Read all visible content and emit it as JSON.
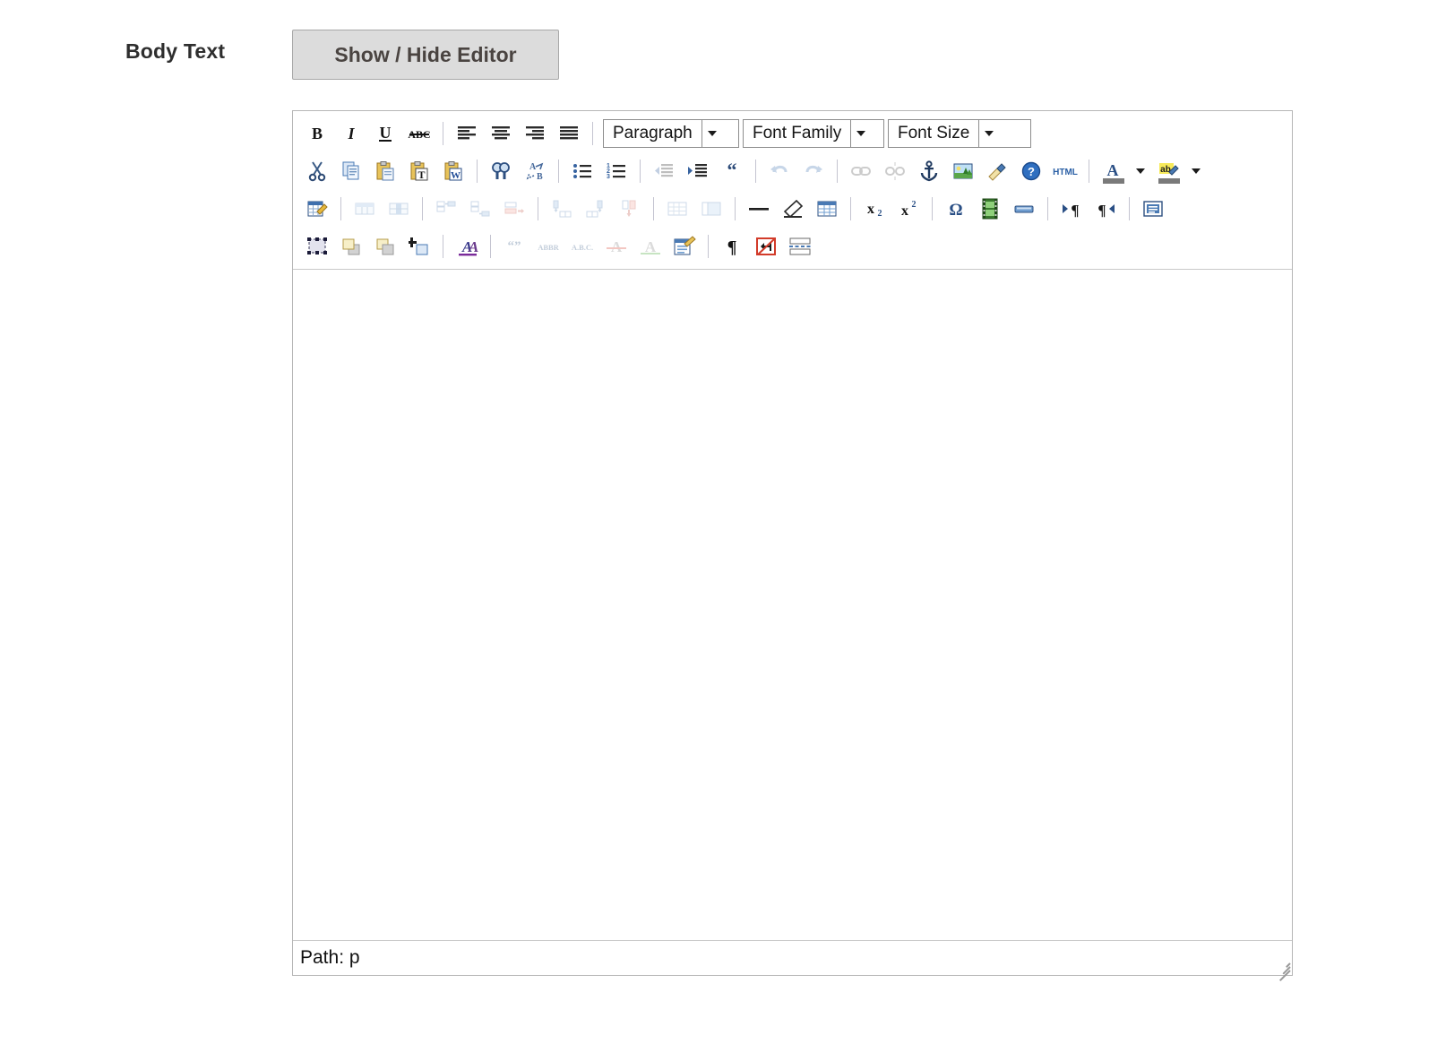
{
  "field": {
    "label": "Body Text",
    "toggle_button_label": "Show / Hide Editor"
  },
  "editor": {
    "name": "tinymce-wysiwyg-editor",
    "status": {
      "path_label": "Path: p"
    },
    "content": {
      "value": "",
      "placeholder": ""
    },
    "dropdowns": [
      {
        "name": "format-select",
        "value": "Paragraph"
      },
      {
        "name": "fontfamily-select",
        "value": "Font Family"
      },
      {
        "name": "fontsize-select",
        "value": "Font Size"
      }
    ],
    "toolbar_rows": [
      {
        "row": 1,
        "buttons": [
          "bold",
          "italic",
          "underline",
          "strikethrough",
          "align-left",
          "align-center",
          "align-right",
          "align-justify"
        ]
      },
      {
        "row": 2,
        "buttons": [
          "cut",
          "copy",
          "paste",
          "paste-as-text",
          "paste-from-word",
          "search",
          "search-replace",
          "bullet-list",
          "numbered-list",
          "outdent",
          "indent",
          "blockquote",
          "undo",
          "redo",
          "link",
          "unlink",
          "anchor",
          "image",
          "cleanup",
          "help",
          "html",
          "forecolor",
          "forecolor-menu",
          "backcolor",
          "backcolor-menu"
        ]
      },
      {
        "row": 3,
        "buttons": [
          "insert-table",
          "table-row-properties",
          "table-cell-properties",
          "row-insert-before",
          "row-insert-after",
          "row-delete",
          "column-insert-before",
          "column-insert-after",
          "column-delete",
          "split-cells",
          "merge-cells",
          "horizontal-rule",
          "remove-formatting",
          "toggle-guidelines",
          "subscript",
          "superscript",
          "special-character",
          "media",
          "insert-date",
          "direction-ltr",
          "direction-rtl",
          "visual-blocks"
        ]
      },
      {
        "row": 4,
        "buttons": [
          "select-layer",
          "move-forward",
          "move-backward",
          "insert-layer",
          "styles",
          "citation",
          "abbreviation",
          "acronym",
          "deleted-text",
          "inserted-text",
          "attributes",
          "show-invisible-characters",
          "nonbreaking-space",
          "page-break"
        ]
      }
    ],
    "colors": {
      "forecolor_swatch": "#7a7a7a",
      "backcolor_swatch": "#7a7a7a",
      "toolbar_border": "#b6b6b6",
      "separator": "#c4c4d0"
    }
  }
}
